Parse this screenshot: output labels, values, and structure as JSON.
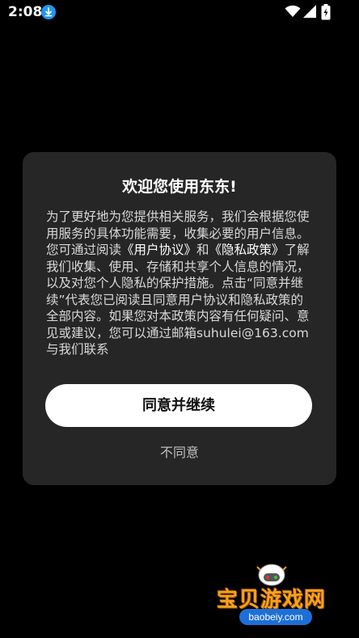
{
  "status_bar": {
    "time": "2:08"
  },
  "dialog": {
    "title": "欢迎您使用东东!",
    "body_parts": {
      "p1": "为了更好地为您提供相关服务，我们会根据您使用服务的具体功能需要，收集必要的用户信息。您可通过阅读",
      "user_agreement": "《用户协议》",
      "and": "和",
      "privacy_policy": "《隐私政策》",
      "p2": "了解我们收集、使用、存储和共享个人信息的情况，以及对您个人隐私的保护措施。点击“同意并继续”代表您已阅读且同意用户协议和隐私政策的全部内容。如果您对本政策内容有任何疑问、意见或建议，您可以通过邮箱suhulei@163.com与我们联系"
    },
    "agree_label": "同意并继续",
    "disagree_label": "不同意"
  },
  "watermark": {
    "name": "宝贝游戏网",
    "domain": "baobeiy.com"
  }
}
